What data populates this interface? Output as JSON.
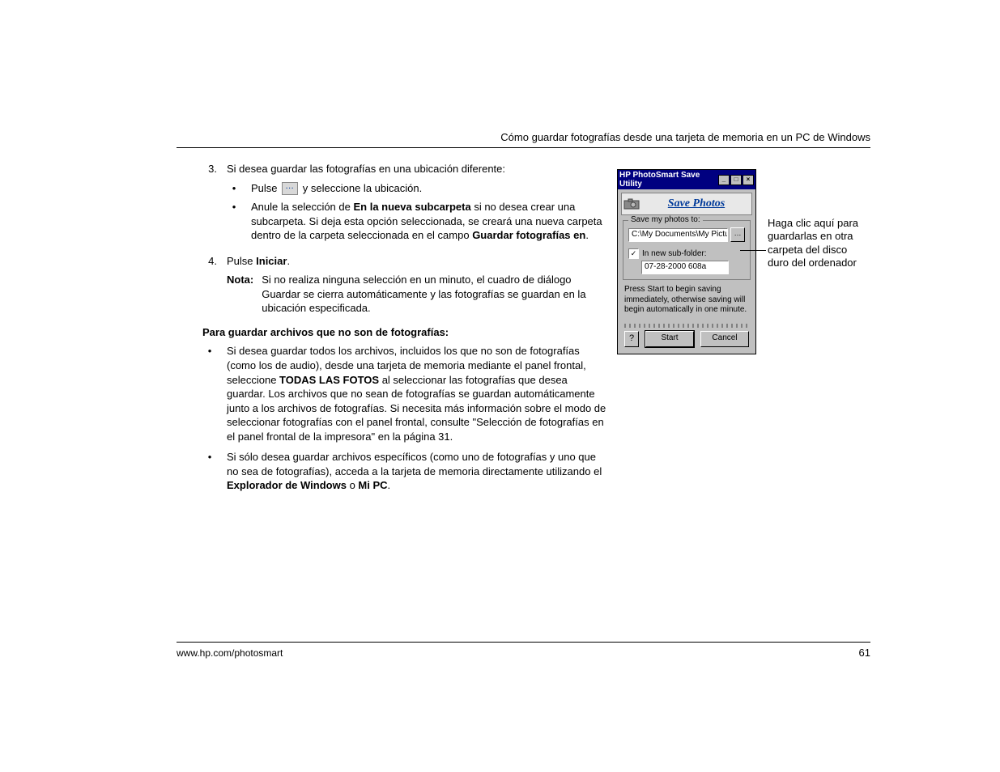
{
  "header": "Cómo guardar fotografías desde una tarjeta de memoria en un PC de Windows",
  "step3": {
    "num": "3.",
    "intro": "Si desea guardar las fotografías en una ubicación diferente:",
    "b1_pre": "Pulse",
    "b1_post": " y seleccione la ubicación.",
    "b2_pre": "Anule la selección de ",
    "b2_bold": "En la nueva subcarpeta",
    "b2_mid": " si no desea crear una subcarpeta. Si deja esta opción seleccionada, se creará una nueva carpeta dentro de la carpeta seleccionada en el campo ",
    "b2_bold2": "Guardar fotografías en",
    "b2_end": "."
  },
  "step4": {
    "num": "4.",
    "pre": "Pulse ",
    "bold": "Iniciar",
    "end": "."
  },
  "note": {
    "label": "Nota:",
    "body": "Si no realiza ninguna selección en un minuto, el cuadro de diálogo Guardar se cierra automáticamente y las fotografías se guardan en la ubicación especificada."
  },
  "subhead": "Para guardar archivos que no son de fotografías:",
  "p1": {
    "a": "Si desea guardar todos los archivos, incluidos los que no son de fotografías (como los de audio), desde una tarjeta de memoria mediante el panel frontal, seleccione ",
    "b": "TODAS LAS FOTOS",
    "c": " al seleccionar las fotografías que desea guardar. Los archivos que no sean de fotografías se guardan automáticamente junto a los archivos de fotografías. Si necesita más información sobre el modo de seleccionar fotografías con el panel frontal, consulte \"Selección de fotografías en el panel frontal de la impresora\" en la página 31."
  },
  "p2": {
    "a": "Si sólo desea guardar archivos específicos (como uno de fotografías y uno que no sea de fotografías), acceda a la tarjeta de memoria directamente utilizando el ",
    "b1": "Explorador de Windows",
    "mid": " o ",
    "b2": "Mi PC",
    "end": "."
  },
  "dialog": {
    "title": "HP PhotoSmart Save Utility",
    "banner": "Save Photos",
    "group_legend": "Save my photos to:",
    "path": "C:\\My Documents\\My Pictures",
    "checkbox_label": "In new sub-folder:",
    "subfolder": "07-28-2000 608a",
    "instructions": "Press Start to begin saving immediately, otherwise saving will begin automatically in one minute.",
    "help": "?",
    "start": "Start",
    "cancel": "Cancel"
  },
  "callout": "Haga clic aquí para guardarlas en otra carpeta del disco duro del ordenador",
  "footer": {
    "url": "www.hp.com/photosmart",
    "page": "61"
  }
}
